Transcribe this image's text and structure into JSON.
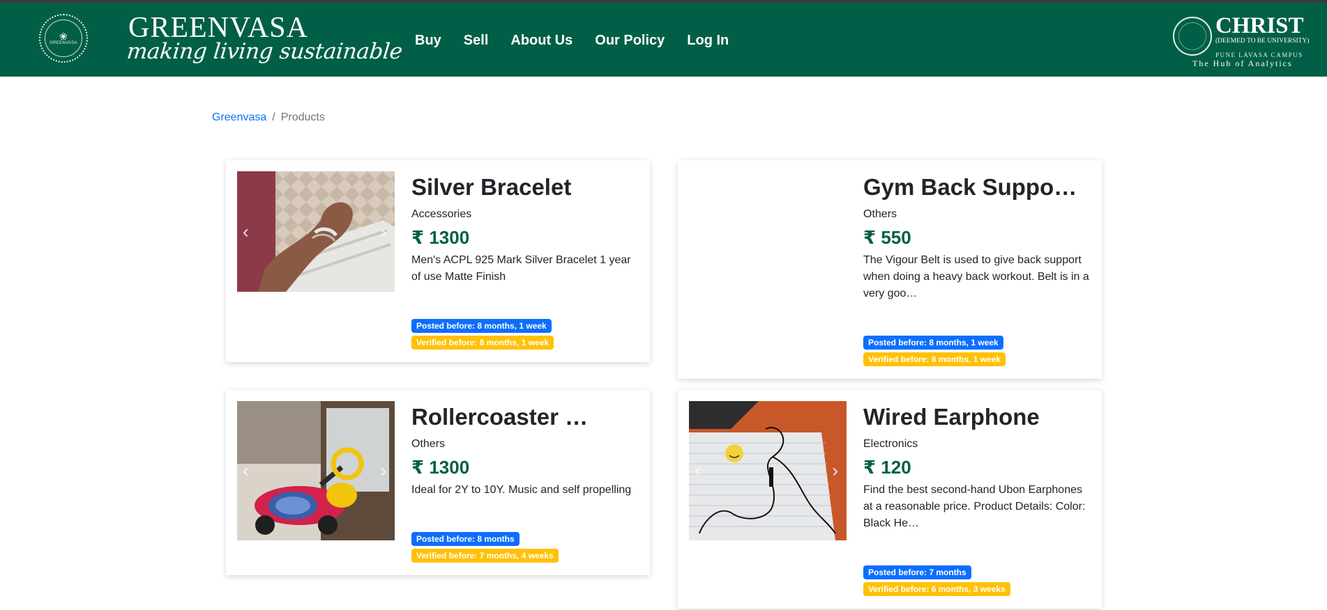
{
  "header": {
    "emblem_text": "GREENVASA",
    "brand_name": "GREENVASA",
    "tagline": "making living sustainable",
    "nav": [
      "Buy",
      "Sell",
      "About Us",
      "Our Policy",
      "Log In"
    ],
    "university": {
      "name": "CHRIST",
      "sub": "(DEEMED TO BE UNIVERSITY)",
      "campus": "PUNE LAVASA CAMPUS",
      "hub": "The Hub of Analytics"
    }
  },
  "breadcrumb": {
    "home": "Greenvasa",
    "separator": "/",
    "current": "Products"
  },
  "currency": "₹",
  "products": [
    {
      "title": "Silver Bracelet",
      "category": "Accessories",
      "price": "₹ 1300",
      "description": "Men's ACPL 925 Mark Silver Bracelet 1 year of use Matte Finish",
      "posted": "Posted before: 8 months, 1 week",
      "verified": "Verified before: 8 months, 1 week"
    },
    {
      "title": "Gym Back Suppo…",
      "category": "Others",
      "price": "₹ 550",
      "description": "The Vigour Belt is used to give back support when doing a heavy back workout. Belt is in a very goo…",
      "posted": "Posted before: 8 months, 1 week",
      "verified": "Verified before: 8 months, 1 week"
    },
    {
      "title": "Rollercoaster …",
      "category": "Others",
      "price": "₹ 1300",
      "description": "Ideal for 2Y to 10Y. Music and self propelling",
      "posted": "Posted before: 8 months",
      "verified": "Verified before: 7 months, 4 weeks"
    },
    {
      "title": "Wired Earphone",
      "category": "Electronics",
      "price": "₹ 120",
      "description": "Find the best second-hand Ubon Earphones at a reasonable price. Product Details: Color: Black He…",
      "posted": "Posted before: 7 months",
      "verified": "Verified before: 6 months, 3 weeks"
    }
  ],
  "carousel": {
    "prev_icon": "chevron-left-icon",
    "next_icon": "chevron-right-icon"
  },
  "colors": {
    "primary_green": "#005f46",
    "badge_blue": "#0d6efd",
    "badge_yellow": "#ffc107",
    "link": "#0d6efd"
  }
}
